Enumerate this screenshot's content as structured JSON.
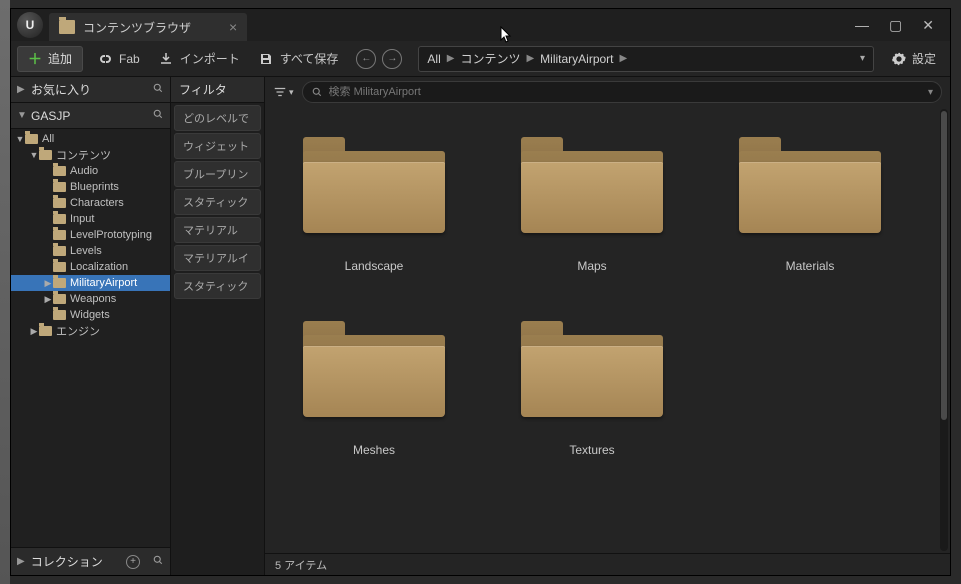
{
  "window": {
    "tab_title": "コンテンツブラウザ",
    "minimize": "—",
    "maximize": "▢",
    "close": "✕"
  },
  "toolbar": {
    "add_label": "追加",
    "fab_label": "Fab",
    "import_label": "インポート",
    "save_all_label": "すべて保存",
    "settings_label": "設定"
  },
  "breadcrumb": {
    "items": [
      "All",
      "コンテンツ",
      "MilitaryAirport"
    ]
  },
  "sidebar": {
    "favorites_label": "お気に入り",
    "project_label": "GASJP",
    "collections_label": "コレクション",
    "tree": [
      {
        "label": "All",
        "depth": 0,
        "expanded": true
      },
      {
        "label": "コンテンツ",
        "depth": 1,
        "expanded": true
      },
      {
        "label": "Audio",
        "depth": 2
      },
      {
        "label": "Blueprints",
        "depth": 2
      },
      {
        "label": "Characters",
        "depth": 2
      },
      {
        "label": "Input",
        "depth": 2
      },
      {
        "label": "LevelPrototyping",
        "depth": 2
      },
      {
        "label": "Levels",
        "depth": 2
      },
      {
        "label": "Localization",
        "depth": 2
      },
      {
        "label": "MilitaryAirport",
        "depth": 2,
        "selected": true,
        "hasChildren": true
      },
      {
        "label": "Weapons",
        "depth": 2,
        "hasChildren": true
      },
      {
        "label": "Widgets",
        "depth": 2
      },
      {
        "label": "エンジン",
        "depth": 1,
        "hasChildren": true
      }
    ]
  },
  "filters": {
    "header": "フィルタ",
    "items": [
      "どのレベルで",
      "ウィジェット",
      "ブループリン",
      "スタティック",
      "マテリアル",
      "マテリアルイ",
      "スタティック"
    ]
  },
  "search": {
    "placeholder": "検索 MilitaryAirport"
  },
  "assets": [
    {
      "label": "Landscape"
    },
    {
      "label": "Maps"
    },
    {
      "label": "Materials"
    },
    {
      "label": "Meshes"
    },
    {
      "label": "Textures"
    }
  ],
  "status": {
    "count_label": "5 アイテム"
  }
}
